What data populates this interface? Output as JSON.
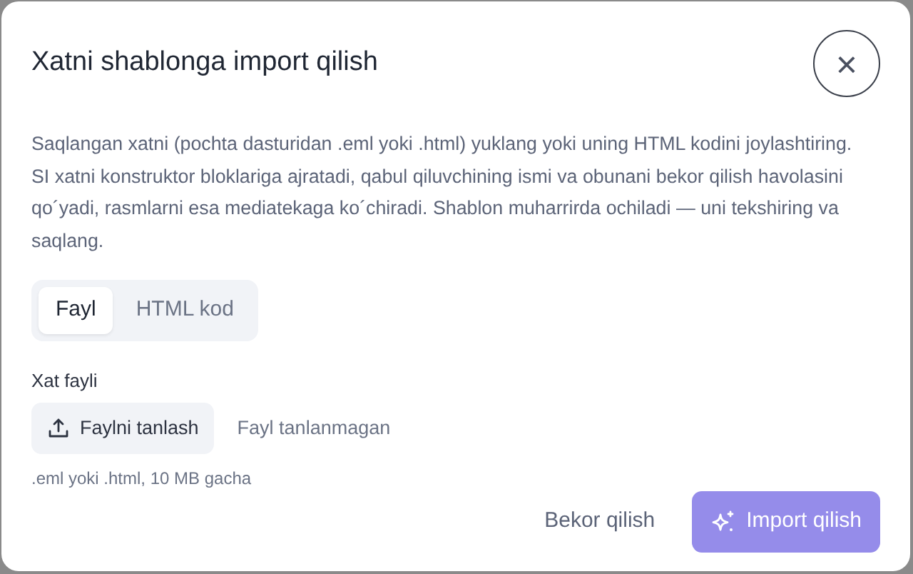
{
  "dialog": {
    "title": "Xatni shablonga import qilish",
    "close_icon": "×",
    "description": "Saqlangan xatni (pochta dasturidan .eml yoki .html) yuklang yoki uning HTML kodini joylashtiring. SI xatni konstruktor bloklariga ajratadi, qabul qiluvchining ismi va obunani bekor qilish havolasini qo´yadi, rasmlarni esa mediatekaga ko´chiradi. Shablon muharrirda ochiladi — uni tekshiring va saqlang.",
    "tabs": [
      {
        "label": "Fayl",
        "selected": true
      },
      {
        "label": "HTML kod",
        "selected": false
      }
    ],
    "file_field": {
      "label": "Xat fayli",
      "button": "Faylni tanlash",
      "status": "Fayl tanlanmagan",
      "hint": ".eml yoki .html, 10 MB gacha"
    },
    "buttons": [
      {
        "label": "Bekor qilish",
        "kind": "cancel"
      },
      {
        "label": "Import qilish",
        "kind": "primary",
        "disabled": true
      }
    ]
  }
}
